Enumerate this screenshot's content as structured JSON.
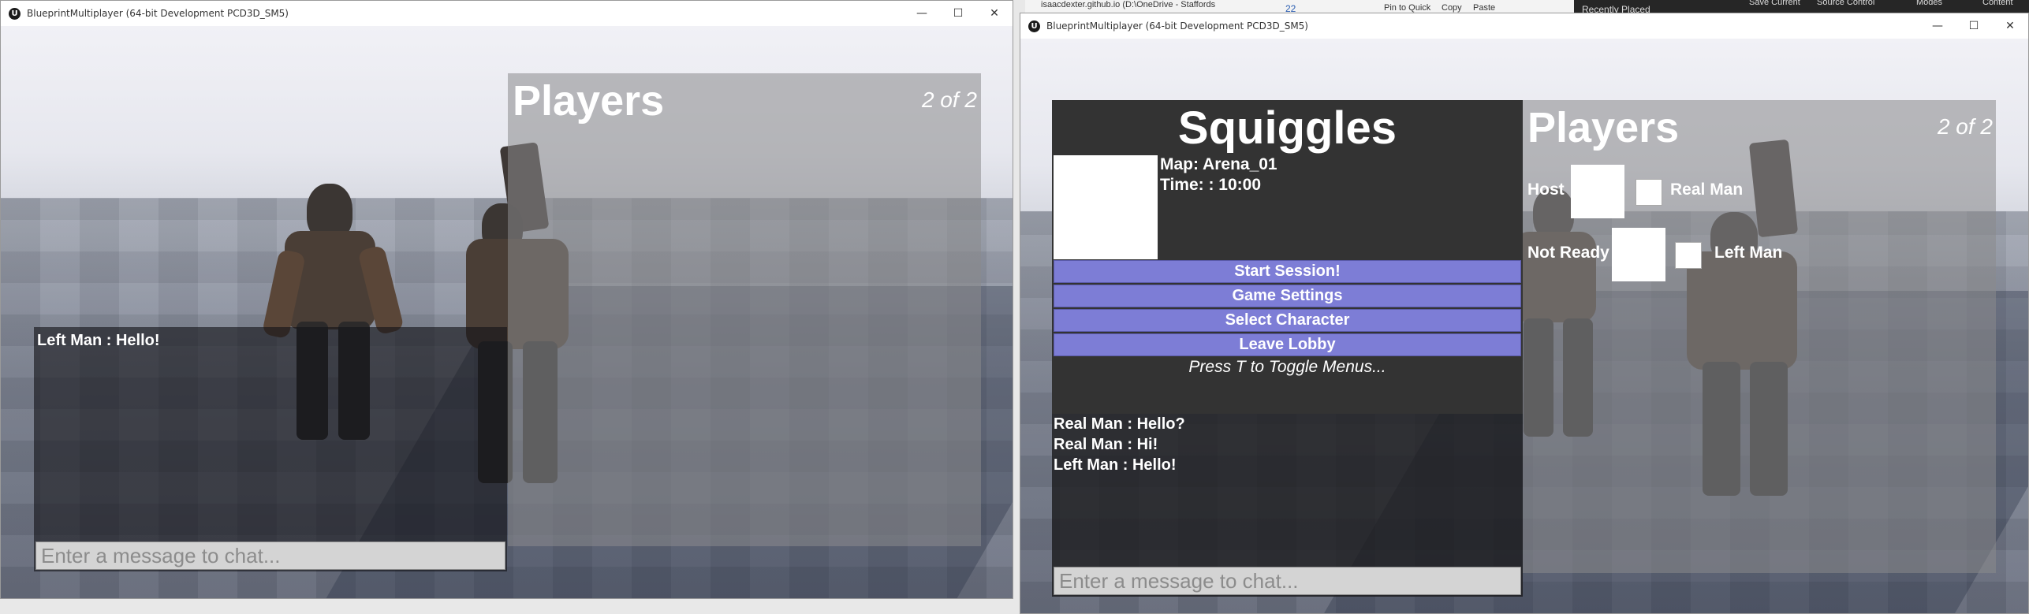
{
  "background_apps": {
    "explorer_badge": "22",
    "explorer_path": "isaacdexter.github.io (D:\\OneDrive - Staffords",
    "ribbon": [
      "Pin to Quick",
      "Copy",
      "Paste"
    ],
    "editor_tabs": [
      "Recently Placed"
    ],
    "editor_toolbar": [
      "Save Current",
      "Source Control",
      "Modes",
      "Content"
    ]
  },
  "left_window": {
    "title": "BlueprintMultiplayer (64-bit Development PCD3D_SM5)",
    "controls": {
      "minimize": "—",
      "maximize": "☐",
      "close": "✕"
    },
    "players": {
      "title": "Players",
      "count": "2 of 2"
    },
    "chat": {
      "messages": [
        "Left Man : Hello!"
      ],
      "input_placeholder": "Enter a message to chat..."
    }
  },
  "right_window": {
    "title": "BlueprintMultiplayer (64-bit Development PCD3D_SM5)",
    "controls": {
      "minimize": "—",
      "maximize": "☐",
      "close": "✕"
    },
    "lobby": {
      "server_name": "Squiggles",
      "map": "Map: Arena_01",
      "time": "Time: : 10:00",
      "buttons": [
        "Start Session!",
        "Game Settings",
        "Select Character",
        "Leave Lobby"
      ],
      "hint": "Press T to Toggle Menus..."
    },
    "chat": {
      "messages": [
        "Real Man : Hello?",
        "Real Man : Hi!",
        "Left Man : Hello!"
      ],
      "input_placeholder": "Enter a message to chat..."
    },
    "players": {
      "title": "Players",
      "count": "2 of 2",
      "rows": [
        {
          "status": "Host",
          "name": "Real Man"
        },
        {
          "status": "Not Ready",
          "name": "Left Man"
        }
      ]
    }
  }
}
